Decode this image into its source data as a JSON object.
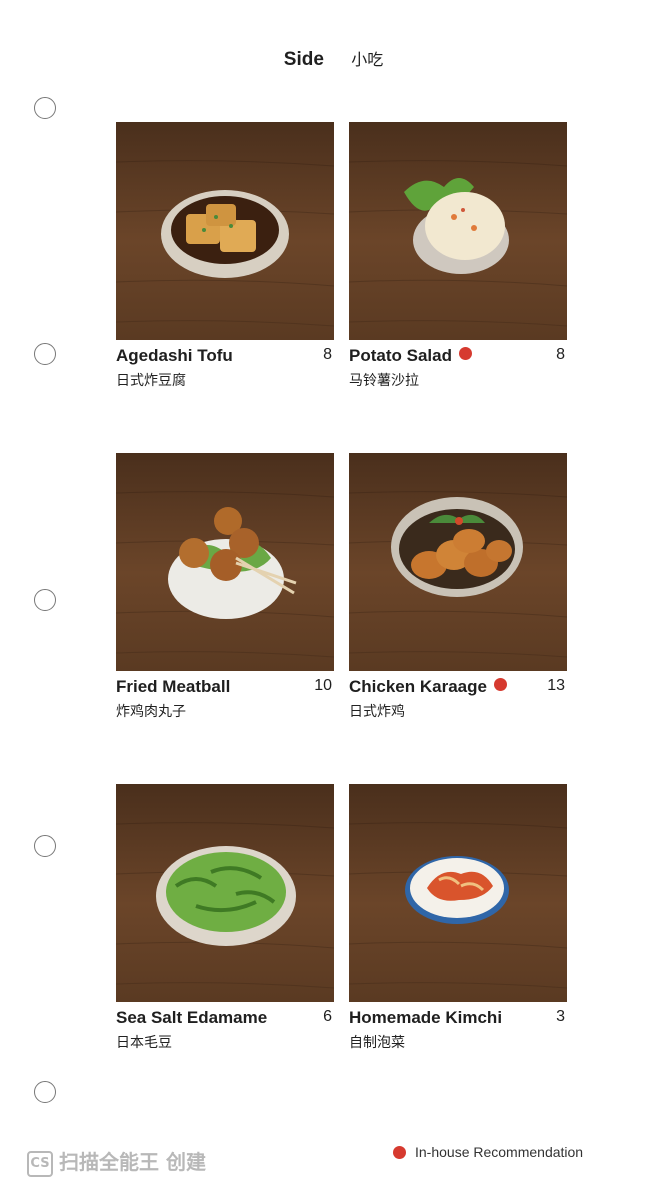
{
  "header": {
    "title_en": "Side",
    "title_zh": "小吃"
  },
  "items": [
    {
      "name": "Agedashi Tofu",
      "name_zh": "日式炸豆腐",
      "price": "8",
      "recommended": false,
      "dish": "tofu"
    },
    {
      "name": "Potato Salad",
      "name_zh": "马铃薯沙拉",
      "price": "8",
      "recommended": true,
      "dish": "salad"
    },
    {
      "name": "Fried Meatball",
      "name_zh": "炸鸡肉丸子",
      "price": "10",
      "recommended": false,
      "dish": "meatball"
    },
    {
      "name": "Chicken Karaage",
      "name_zh": "日式炸鸡",
      "price": "13",
      "recommended": true,
      "dish": "karaage"
    },
    {
      "name": "Sea Salt Edamame",
      "name_zh": "日本毛豆",
      "price": "6",
      "recommended": false,
      "dish": "edamame"
    },
    {
      "name": "Homemade Kimchi",
      "name_zh": "自制泡菜",
      "price": "3",
      "recommended": false,
      "dish": "kimchi"
    }
  ],
  "legend": {
    "label": "In-house Recommendation"
  },
  "watermark": {
    "logo": "CS",
    "text": "扫描全能王 创建"
  },
  "colors": {
    "recommend_dot": "#d63a2f",
    "wood": "#5a3a22"
  }
}
